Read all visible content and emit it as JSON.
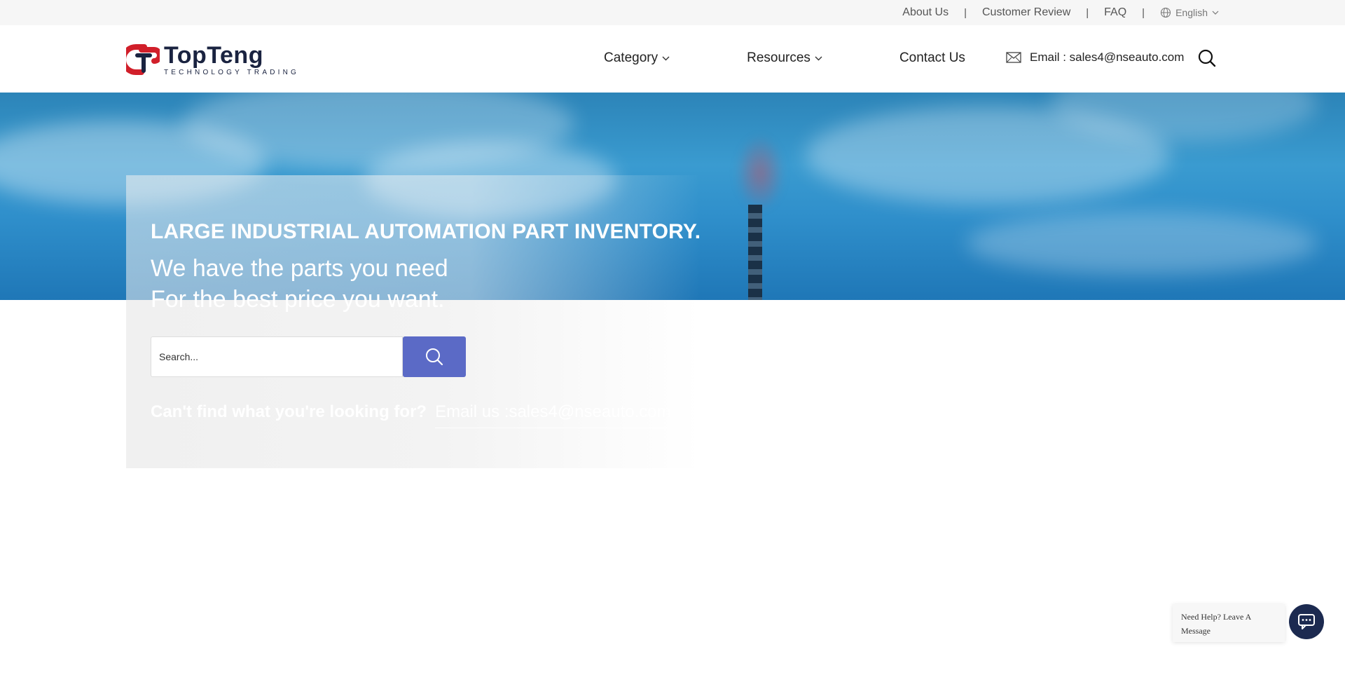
{
  "topbar": {
    "links": [
      "About Us",
      "Customer Review",
      "FAQ"
    ],
    "separator": "|",
    "language": "English"
  },
  "header": {
    "logo_name": "TopTeng",
    "logo_sub": "TECHNOLOGY TRADING",
    "nav": {
      "category": "Category",
      "resources": "Resources",
      "contact": "Contact Us"
    },
    "email_label": "Email : sales4@nseauto.com"
  },
  "hero": {
    "headline": "LARGE INDUSTRIAL AUTOMATION PART INVENTORY.",
    "line1": "We have the parts you need",
    "line2": "For the best price you want.",
    "search_placeholder": "Search...",
    "cant_find": "Can't find what you're looking for?",
    "email_us": "Email us :sales4@nseauto.com"
  },
  "chat": {
    "message": "Need Help? Leave A Message"
  },
  "colors": {
    "search_button": "#5b6ac6",
    "chat_button": "#1c2a50",
    "logo_red": "#d11f2a",
    "logo_navy": "#1a2340"
  },
  "icons": [
    "globe-icon",
    "chevron-down-icon",
    "mail-icon",
    "search-icon",
    "chat-icon"
  ]
}
